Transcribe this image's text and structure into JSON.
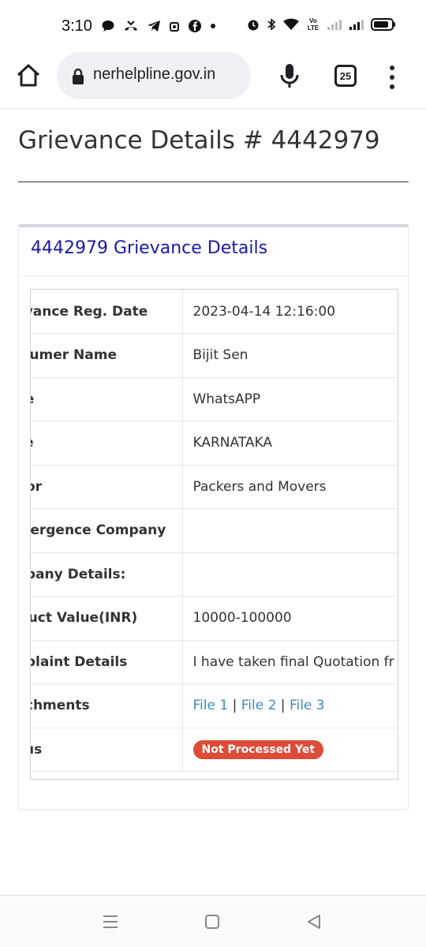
{
  "status_bar": {
    "time": "3:10",
    "left_icons": [
      "chat-icon",
      "missed-call-icon",
      "telegram-icon",
      "recorder-icon",
      "facebook-icon",
      "dot-icon"
    ],
    "right_icons": [
      "alarm-icon",
      "bluetooth-icon",
      "wifi-icon",
      "volte-icon",
      "signal-icon",
      "signal-icon",
      "battery-icon"
    ],
    "volte_label": "Vo LTE"
  },
  "browser": {
    "url": "nerhelpline.gov.in",
    "tab_count": "25"
  },
  "page": {
    "title": "Grievance Details # 4442979",
    "panel_title": "4442979 Grievance Details"
  },
  "details": {
    "rows": [
      {
        "label": "Grievance Reg. Date",
        "value": "2023-04-14 12:16:00"
      },
      {
        "label": "Consumer Name",
        "value": "Bijit Sen"
      },
      {
        "label": "Mode",
        "value": "WhatsAPP"
      },
      {
        "label": "State",
        "value": "KARNATAKA"
      },
      {
        "label": "Sector",
        "value": "Packers and Movers"
      },
      {
        "label": "Convergence Company",
        "value": ""
      },
      {
        "label": "Company Details:",
        "value": ""
      },
      {
        "label": "Product Value(INR)",
        "value": "10000-100000"
      },
      {
        "label": "Complaint Details",
        "value": "I have taken final Quotation fr"
      }
    ],
    "attachments_label": "Attachments",
    "files": [
      "File 1",
      "File 2",
      "File 3"
    ],
    "separator": "|",
    "status_label": "Status",
    "status_value": "Not Processed Yet"
  },
  "colors": {
    "link": "#3c8dbc",
    "panel_title": "#1a1aa6",
    "badge": "#dd4b39"
  }
}
